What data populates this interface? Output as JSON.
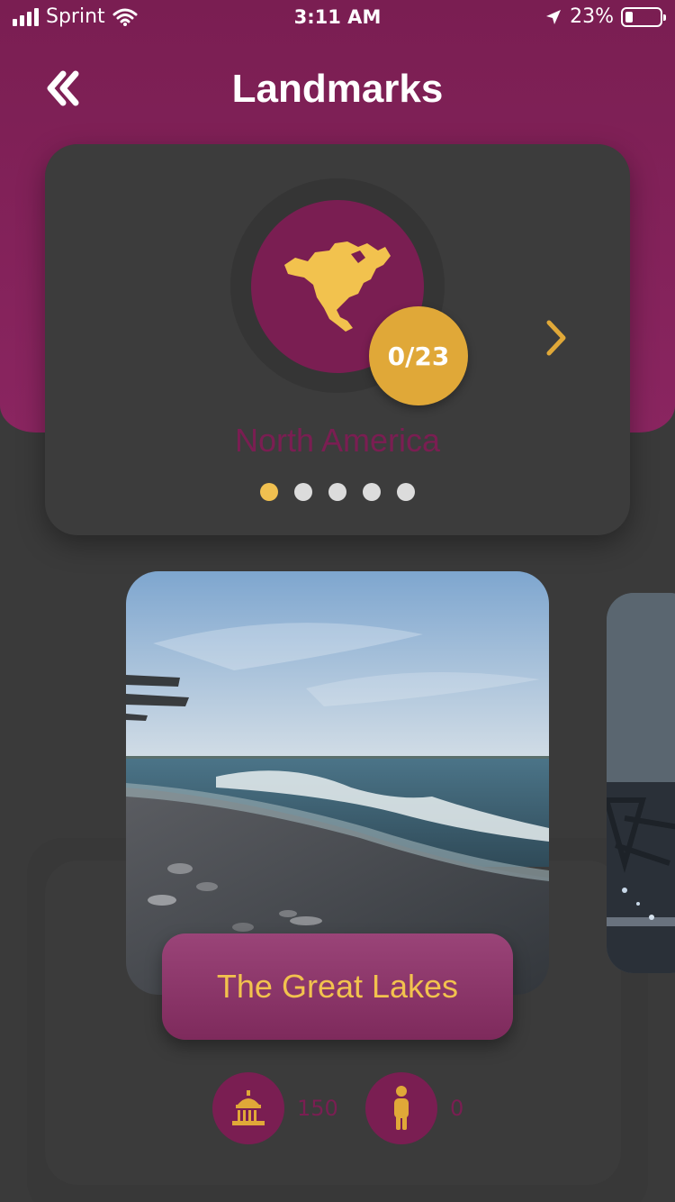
{
  "status_bar": {
    "carrier": "Sprint",
    "time": "3:11 AM",
    "battery": "23%"
  },
  "header": {
    "title": "Landmarks",
    "back_icon": "double-chevron-left-icon"
  },
  "region": {
    "name": "North America",
    "progress": "0/23",
    "icon": "north-america-icon",
    "next_icon": "chevron-right-icon",
    "page_count": 5,
    "active_page": 0
  },
  "landmark": {
    "title": "The Great Lakes",
    "image": "lake-shore-photo"
  },
  "stats": {
    "landmarks_count": "150",
    "people_count": "0"
  },
  "colors": {
    "primary": "#7a1e52",
    "accent": "#e0a838",
    "background": "#3a3a3a",
    "label_text": "#f2c24e"
  }
}
